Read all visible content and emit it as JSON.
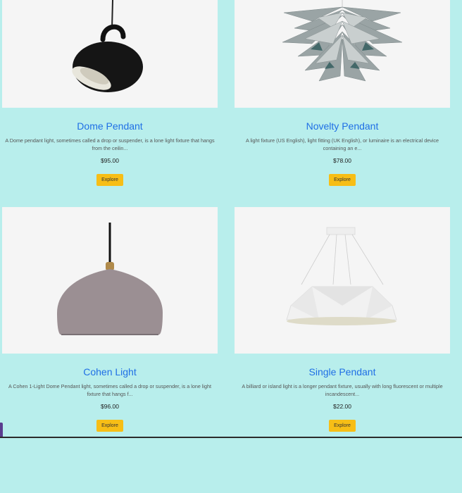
{
  "products": [
    {
      "title": "Dome Pendant",
      "description": "A Dome pendant light, sometimes called a drop or suspender, is a lone light fixture that hangs from the ceilin...",
      "price": "$95.00",
      "button": "Explore"
    },
    {
      "title": "Novelty Pendant",
      "description": "A light fixture (US English), light fitting (UK English), or luminaire is an electrical device containing an e...",
      "price": "$78.00",
      "button": "Explore"
    },
    {
      "title": "Cohen Light",
      "description": "A Cohen 1-Light Dome Pendant light, sometimes called a drop or suspender, is a lone light fixture that hangs f...",
      "price": "$96.00",
      "button": "Explore"
    },
    {
      "title": "Single Pendant",
      "description": "A billiard or island light is a longer pendant fixture, usually with long fluorescent or multiple incandescent...",
      "price": "$22.00",
      "button": "Explore"
    }
  ],
  "colors": {
    "background": "#b8eeec",
    "title": "#1f6fe5",
    "button": "#f7be16"
  }
}
